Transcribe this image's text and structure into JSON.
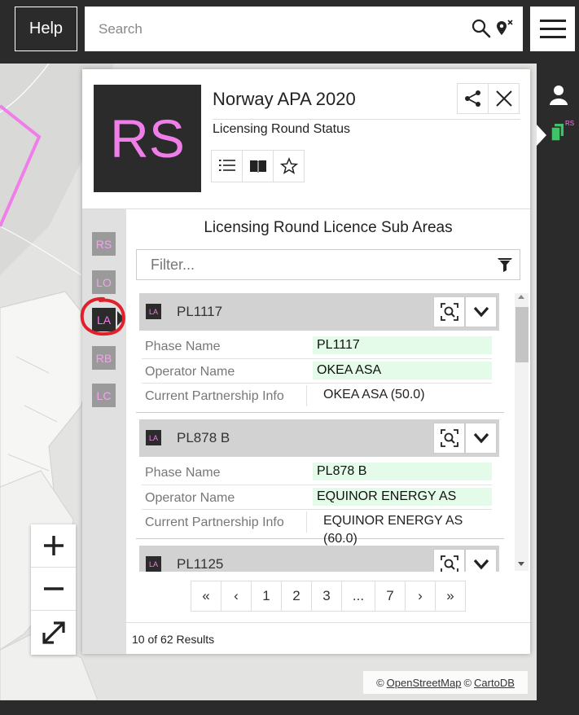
{
  "header": {
    "help_label": "Help",
    "search_placeholder": "Search",
    "search_icon": "search-icon",
    "locate_icon": "location-clear-icon",
    "menu_icon": "hamburger-menu-icon"
  },
  "panel": {
    "logo_text": "RS",
    "title": "Norway APA 2020",
    "subtitle": "Licensing Round Status",
    "toolbar_icons": [
      "list-icon",
      "book-icon",
      "star-icon"
    ],
    "section_title": "Licensing Round Licence Sub Areas",
    "filter_placeholder": "Filter...",
    "side_tabs": [
      "RS",
      "LO",
      "LA",
      "RB",
      "LC"
    ],
    "active_tab": "LA"
  },
  "cards": [
    {
      "icon": "LA",
      "name": "PL1117",
      "rows": [
        {
          "label": "Phase Name",
          "value": "PL1117"
        },
        {
          "label": "Operator Name",
          "value": "OKEA ASA"
        },
        {
          "label": "Current Partnership Info",
          "value": "OKEA ASA (50.0)"
        }
      ]
    },
    {
      "icon": "LA",
      "name": "PL878 B",
      "rows": [
        {
          "label": "Phase Name",
          "value": "PL878 B"
        },
        {
          "label": "Operator Name",
          "value": "EQUINOR ENERGY AS"
        },
        {
          "label": "Current Partnership Info",
          "value": "EQUINOR ENERGY AS (60.0)"
        }
      ]
    },
    {
      "icon": "LA",
      "name": "PL1125",
      "rows": []
    }
  ],
  "pagination": {
    "first": "«",
    "prev": "‹",
    "pages": [
      "1",
      "2",
      "3",
      "...",
      "7"
    ],
    "next": "›",
    "last": "»"
  },
  "results_text": "10 of 62 Results",
  "rail": {
    "user_icon": "user-icon",
    "layers_badge": "RS"
  },
  "map": {
    "attribution_prefix": "©",
    "osm_link": "OpenStreetMap",
    "carto_link": "CartoDB"
  },
  "colors": {
    "accent_pink": "#f07ee9",
    "dark": "#2b2b2b",
    "highlight_green": "#e4fbe9",
    "annotation_red": "#e0202a",
    "rail_green": "#3ec466"
  }
}
